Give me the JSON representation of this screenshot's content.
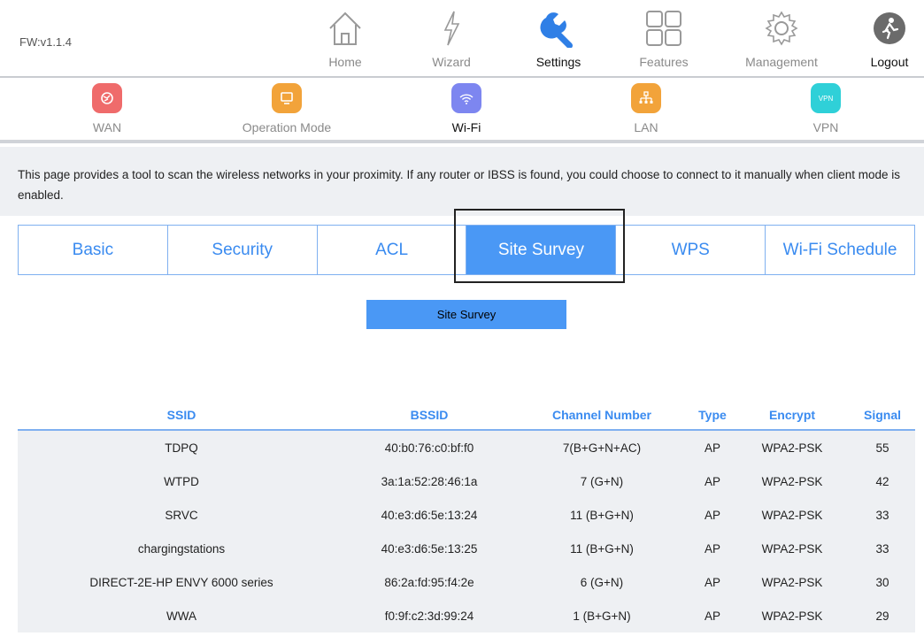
{
  "header": {
    "firmware": "FW:v1.1.4",
    "nav": [
      {
        "label": "Home",
        "icon": "home-icon"
      },
      {
        "label": "Wizard",
        "icon": "wizard-icon"
      },
      {
        "label": "Settings",
        "icon": "wrench-icon",
        "active": true
      },
      {
        "label": "Features",
        "icon": "grid-icon"
      },
      {
        "label": "Management",
        "icon": "gear-icon"
      },
      {
        "label": "Logout",
        "icon": "logout-icon"
      }
    ]
  },
  "subnav": [
    {
      "label": "WAN",
      "color": "#ef6b6b"
    },
    {
      "label": "Operation Mode",
      "color": "#f2a33a"
    },
    {
      "label": "Wi-Fi",
      "color": "#7d86f0",
      "active": true
    },
    {
      "label": "LAN",
      "color": "#f2a33a"
    },
    {
      "label": "VPN",
      "color": "#2fd0d8",
      "badge_text": "VPN"
    }
  ],
  "description": "This page provides a tool to scan the wireless networks in your proximity. If any router or IBSS is found, you could choose to connect to it manually when client mode is enabled.",
  "tabs": [
    "Basic",
    "Security",
    "ACL",
    "Site Survey",
    "WPS",
    "Wi-Fi Schedule"
  ],
  "active_tab": "Site Survey",
  "survey_button": "Site Survey",
  "table": {
    "headers": [
      "SSID",
      "BSSID",
      "Channel Number",
      "Type",
      "Encrypt",
      "Signal"
    ],
    "rows": [
      [
        "TDPQ",
        "40:b0:76:c0:bf:f0",
        "7(B+G+N+AC)",
        "AP",
        "WPA2-PSK",
        "55"
      ],
      [
        "WTPD",
        "3a:1a:52:28:46:1a",
        "7 (G+N)",
        "AP",
        "WPA2-PSK",
        "42"
      ],
      [
        "SRVC",
        "40:e3:d6:5e:13:24",
        "11 (B+G+N)",
        "AP",
        "WPA2-PSK",
        "33"
      ],
      [
        "chargingstations",
        "40:e3:d6:5e:13:25",
        "11 (B+G+N)",
        "AP",
        "WPA2-PSK",
        "33"
      ],
      [
        "DIRECT-2E-HP ENVY 6000 series",
        "86:2a:fd:95:f4:2e",
        "6 (G+N)",
        "AP",
        "WPA2-PSK",
        "30"
      ],
      [
        "WWA",
        "f0:9f:c2:3d:99:24",
        "1 (B+G+N)",
        "AP",
        "WPA2-PSK",
        "29"
      ]
    ]
  },
  "colors": {
    "accent": "#4a98f5",
    "table_bg": "#eef0f3"
  }
}
